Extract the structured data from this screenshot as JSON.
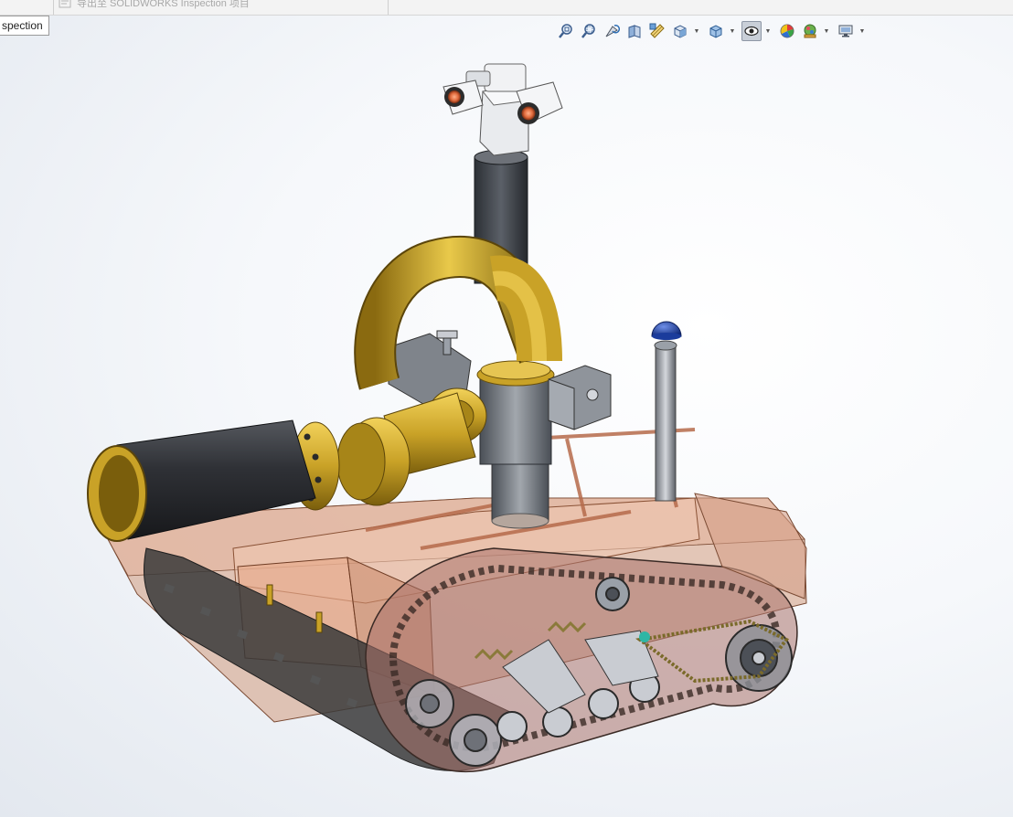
{
  "top_bar": {
    "faded_command": "导出至 SOLIDWORKS Inspection 项目"
  },
  "panel_tab": {
    "label": "spection"
  },
  "toolbar": {
    "buttons": [
      {
        "icon": "zoom-to-fit-icon",
        "dropdown": false
      },
      {
        "icon": "zoom-to-area-icon",
        "dropdown": false
      },
      {
        "icon": "previous-view-icon",
        "dropdown": false
      },
      {
        "icon": "section-view-icon",
        "dropdown": false
      },
      {
        "icon": "dynamic-annotation-views-icon",
        "dropdown": false
      },
      {
        "icon": "view-orientation-icon",
        "dropdown": true
      },
      {
        "icon": "display-style-icon",
        "dropdown": true
      },
      {
        "icon": "hide-show-items-icon",
        "dropdown": true,
        "active": true
      },
      {
        "icon": "edit-appearance-icon",
        "dropdown": false
      },
      {
        "icon": "apply-scene-icon",
        "dropdown": true
      },
      {
        "icon": "view-settings-icon",
        "dropdown": true
      }
    ]
  },
  "colors": {
    "tube_brass": "#c9a227",
    "hull_translucent": "#c98b6e",
    "track_dark": "#3a3a3a",
    "camera_lens": "#e06a3c",
    "mast_dark": "#3b3f45",
    "beacon_blue": "#1b3c9c",
    "barrel_black": "#2b2d31",
    "frame_copper": "#e8b49a"
  }
}
